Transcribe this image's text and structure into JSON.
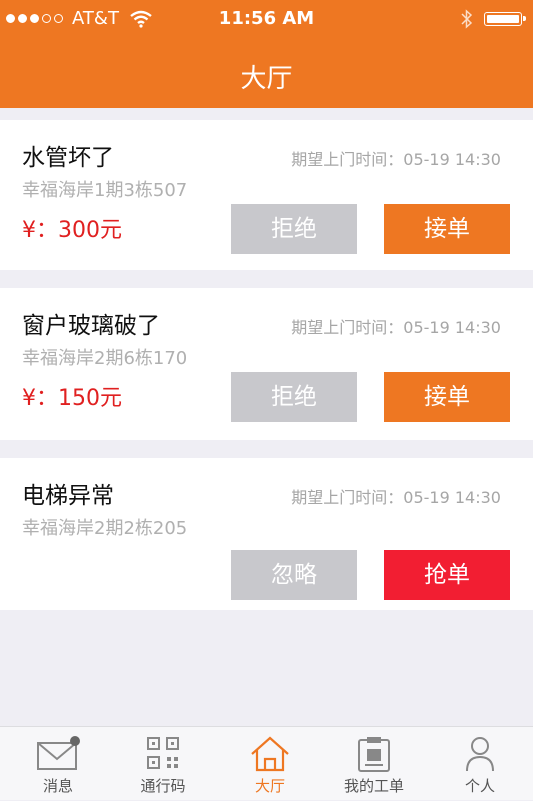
{
  "status_bar": {
    "carrier": "AT&T",
    "time": "11:56 AM"
  },
  "header": {
    "title": "大厅"
  },
  "orders": [
    {
      "title": "水管坏了",
      "time": "期望上门时间：05-19  14:30",
      "address": "幸福海岸1期3栋507",
      "price": "¥：300元",
      "left_button": "拒绝",
      "right_button": "接单"
    },
    {
      "title": "窗户玻璃破了",
      "time": "期望上门时间：05-19  14:30",
      "address": "幸福海岸2期6栋170",
      "price": "¥：150元",
      "left_button": "拒绝",
      "right_button": "接单"
    },
    {
      "title": "电梯异常",
      "time": "期望上门时间：05-19  14:30",
      "address": "幸福海岸2期2栋205",
      "left_button": "忽略",
      "right_button": "抢单"
    }
  ],
  "tabs": [
    {
      "label": "消息",
      "icon": "envelope-icon"
    },
    {
      "label": "通行码",
      "icon": "qr-code-icon"
    },
    {
      "label": "大厅",
      "icon": "home-icon",
      "active": true
    },
    {
      "label": "我的工单",
      "icon": "clipboard-icon"
    },
    {
      "label": "个人",
      "icon": "person-icon"
    }
  ],
  "colors": {
    "accent": "#ee7722",
    "grab": "#f21e32",
    "price": "#e02020",
    "disabled_button": "#c8c8cc"
  }
}
